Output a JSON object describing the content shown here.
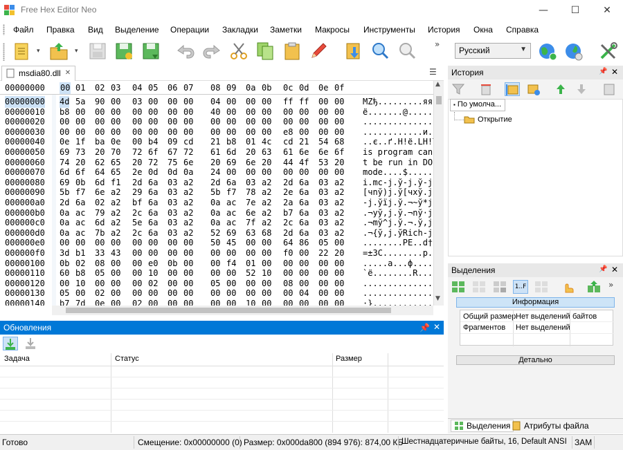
{
  "window": {
    "title": "Free Hex Editor Neo",
    "minimize": "—",
    "maximize": "☐",
    "close": "✕"
  },
  "menu": [
    "Файл",
    "Правка",
    "Вид",
    "Выделение",
    "Операции",
    "Закладки",
    "Заметки",
    "Макросы",
    "Инструменты",
    "История",
    "Окна",
    "Справка"
  ],
  "toolbar": {
    "language": "Русский",
    "overflow": "»"
  },
  "document": {
    "tab_name": "msdia80.dll",
    "tab_close": "✕",
    "tab_menu": "☰"
  },
  "hex": {
    "header_addr": "00000000",
    "header_cols": [
      "00",
      "01",
      "02",
      "03",
      "04",
      "05",
      "06",
      "07",
      "08",
      "09",
      "0a",
      "0b",
      "0c",
      "0d",
      "0e",
      "0f"
    ],
    "rows": [
      {
        "addr": "00000000",
        "bytes": [
          "4d",
          "5a",
          "90",
          "00",
          "03",
          "00",
          "00",
          "00",
          "04",
          "00",
          "00",
          "00",
          "ff",
          "ff",
          "00",
          "00"
        ],
        "text": "MZђ.........яя.."
      },
      {
        "addr": "00000010",
        "bytes": [
          "b8",
          "00",
          "00",
          "00",
          "00",
          "00",
          "00",
          "00",
          "40",
          "00",
          "00",
          "00",
          "00",
          "00",
          "00",
          "00"
        ],
        "text": "ё.......@......."
      },
      {
        "addr": "00000020",
        "bytes": [
          "00",
          "00",
          "00",
          "00",
          "00",
          "00",
          "00",
          "00",
          "00",
          "00",
          "00",
          "00",
          "00",
          "00",
          "00",
          "00"
        ],
        "text": "................"
      },
      {
        "addr": "00000030",
        "bytes": [
          "00",
          "00",
          "00",
          "00",
          "00",
          "00",
          "00",
          "00",
          "00",
          "00",
          "00",
          "00",
          "e8",
          "00",
          "00",
          "00"
        ],
        "text": "............и..."
      },
      {
        "addr": "00000040",
        "bytes": [
          "0e",
          "1f",
          "ba",
          "0e",
          "00",
          "b4",
          "09",
          "cd",
          "21",
          "b8",
          "01",
          "4c",
          "cd",
          "21",
          "54",
          "68"
        ],
        "text": "..є..ґ.Н!ё.LН!Th"
      },
      {
        "addr": "00000050",
        "bytes": [
          "69",
          "73",
          "20",
          "70",
          "72",
          "6f",
          "67",
          "72",
          "61",
          "6d",
          "20",
          "63",
          "61",
          "6e",
          "6e",
          "6f"
        ],
        "text": "is program canno"
      },
      {
        "addr": "00000060",
        "bytes": [
          "74",
          "20",
          "62",
          "65",
          "20",
          "72",
          "75",
          "6e",
          "20",
          "69",
          "6e",
          "20",
          "44",
          "4f",
          "53",
          "20"
        ],
        "text": "t be run in DOS "
      },
      {
        "addr": "00000070",
        "bytes": [
          "6d",
          "6f",
          "64",
          "65",
          "2e",
          "0d",
          "0d",
          "0a",
          "24",
          "00",
          "00",
          "00",
          "00",
          "00",
          "00",
          "00"
        ],
        "text": "mode....$......."
      },
      {
        "addr": "00000080",
        "bytes": [
          "69",
          "0b",
          "6d",
          "f1",
          "2d",
          "6a",
          "03",
          "a2",
          "2d",
          "6a",
          "03",
          "a2",
          "2d",
          "6a",
          "03",
          "a2"
        ],
        "text": "i.mс-j.ў-j.ў-j.ў"
      },
      {
        "addr": "00000090",
        "bytes": [
          "5b",
          "f7",
          "6e",
          "a2",
          "29",
          "6a",
          "03",
          "a2",
          "5b",
          "f7",
          "78",
          "a2",
          "2e",
          "6a",
          "03",
          "a2"
        ],
        "text": "[чnў)j.ў[чxў.j.ў"
      },
      {
        "addr": "000000a0",
        "bytes": [
          "2d",
          "6a",
          "02",
          "a2",
          "bf",
          "6a",
          "03",
          "a2",
          "0a",
          "ac",
          "7e",
          "a2",
          "2a",
          "6a",
          "03",
          "a2"
        ],
        "text": "-j.ўїj.ў.¬~ў*j.ў"
      },
      {
        "addr": "000000b0",
        "bytes": [
          "0a",
          "ac",
          "79",
          "a2",
          "2c",
          "6a",
          "03",
          "a2",
          "0a",
          "ac",
          "6e",
          "a2",
          "b7",
          "6a",
          "03",
          "a2"
        ],
        "text": ".¬yў,j.ў.¬nў·j.ў"
      },
      {
        "addr": "000000c0",
        "bytes": [
          "0a",
          "ac",
          "6d",
          "a2",
          "5e",
          "6a",
          "03",
          "a2",
          "0a",
          "ac",
          "7f",
          "a2",
          "2c",
          "6a",
          "03",
          "a2"
        ],
        "text": ".¬mў^j.ў.¬.ў,j.ў"
      },
      {
        "addr": "000000d0",
        "bytes": [
          "0a",
          "ac",
          "7b",
          "a2",
          "2c",
          "6a",
          "03",
          "a2",
          "52",
          "69",
          "63",
          "68",
          "2d",
          "6a",
          "03",
          "a2"
        ],
        "text": ".¬{ў,j.ўRich-j.ў"
      },
      {
        "addr": "000000e0",
        "bytes": [
          "00",
          "00",
          "00",
          "00",
          "00",
          "00",
          "00",
          "00",
          "50",
          "45",
          "00",
          "00",
          "64",
          "86",
          "05",
          "00"
        ],
        "text": "........PE..d†.."
      },
      {
        "addr": "000000f0",
        "bytes": [
          "3d",
          "b1",
          "33",
          "43",
          "00",
          "00",
          "00",
          "00",
          "00",
          "00",
          "00",
          "00",
          "f0",
          "00",
          "22",
          "20"
        ],
        "text": "=±3C........р.\" "
      },
      {
        "addr": "00000100",
        "bytes": [
          "0b",
          "02",
          "08",
          "00",
          "00",
          "e0",
          "0b",
          "00",
          "00",
          "f4",
          "01",
          "00",
          "00",
          "00",
          "00",
          "00"
        ],
        "text": ".....а...ф......"
      },
      {
        "addr": "00000110",
        "bytes": [
          "60",
          "b8",
          "05",
          "00",
          "00",
          "10",
          "00",
          "00",
          "00",
          "00",
          "52",
          "10",
          "00",
          "00",
          "00",
          "00"
        ],
        "text": "`ё........R....."
      },
      {
        "addr": "00000120",
        "bytes": [
          "00",
          "10",
          "00",
          "00",
          "00",
          "02",
          "00",
          "00",
          "05",
          "00",
          "00",
          "00",
          "08",
          "00",
          "00",
          "00"
        ],
        "text": "................"
      },
      {
        "addr": "00000130",
        "bytes": [
          "05",
          "00",
          "02",
          "00",
          "00",
          "00",
          "00",
          "00",
          "00",
          "00",
          "00",
          "00",
          "00",
          "04",
          "00",
          "00"
        ],
        "text": "................"
      },
      {
        "addr": "00000140",
        "bytes": [
          "b7",
          "7d",
          "0e",
          "00",
          "02",
          "00",
          "00",
          "00",
          "00",
          "00",
          "10",
          "00",
          "00",
          "00",
          "00",
          "00"
        ],
        "text": "·}.............."
      }
    ]
  },
  "updates": {
    "title": "Обновления",
    "columns": [
      "Задача",
      "Статус",
      "Размер"
    ]
  },
  "history": {
    "title": "История",
    "root": "По умолча...",
    "child": "Открытие"
  },
  "selections": {
    "title": "Выделения",
    "info_label": "Информация",
    "rows": [
      {
        "label": "Общий размер",
        "value": "Нет выделений",
        "unit": "байтов"
      },
      {
        "label": "Фрагментов",
        "value": "Нет выделений",
        "unit": ""
      }
    ],
    "detail_label": "Детально",
    "tab_selections": "Выделения",
    "tab_file_attrs": "Атрибуты файла"
  },
  "status": {
    "ready": "Готово",
    "offset": "Смещение: 0x00000000 (0)",
    "size": "Размер: 0x000da800 (894 976): 874,00 КБ",
    "mode": "Шестнадцатеричные байты, 16, Default ANSI",
    "ins": "ЗАМ"
  },
  "colors": {
    "accent": "#0078d7",
    "hex_highlight": "#cde2f6",
    "info_bar": "#cde4f7"
  }
}
